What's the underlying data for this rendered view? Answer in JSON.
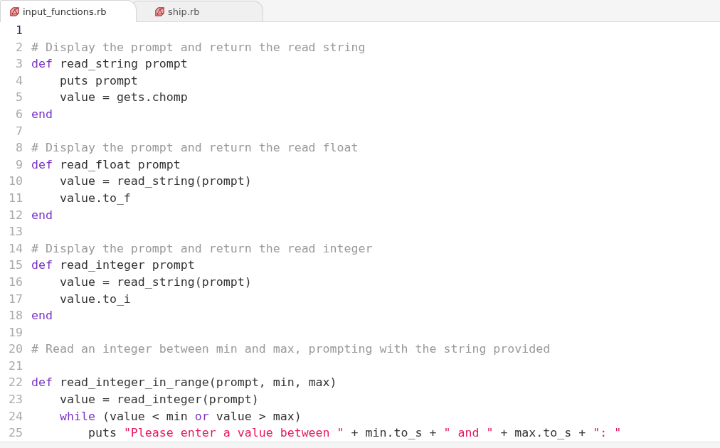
{
  "tabs": [
    {
      "label": "input_functions.rb",
      "selected": true
    },
    {
      "label": "ship.rb",
      "selected": false
    }
  ],
  "editor": {
    "lines": [
      {
        "number": "1",
        "current": true
      },
      {
        "number": "2",
        "tokens": [
          {
            "kind": "comment",
            "text": "# Display the prompt and return the read string"
          }
        ]
      },
      {
        "number": "3",
        "tokens": [
          {
            "kind": "keyword",
            "text": "def"
          },
          {
            "kind": "plain",
            "text": " read_string prompt"
          }
        ]
      },
      {
        "number": "4",
        "tokens": [
          {
            "kind": "plain",
            "text": "    puts prompt"
          }
        ]
      },
      {
        "number": "5",
        "tokens": [
          {
            "kind": "plain",
            "text": "    value = gets.chomp"
          }
        ]
      },
      {
        "number": "6",
        "tokens": [
          {
            "kind": "keyword",
            "text": "end"
          }
        ]
      },
      {
        "number": "7"
      },
      {
        "number": "8",
        "tokens": [
          {
            "kind": "comment",
            "text": "# Display the prompt and return the read float"
          }
        ]
      },
      {
        "number": "9",
        "tokens": [
          {
            "kind": "keyword",
            "text": "def"
          },
          {
            "kind": "plain",
            "text": " read_float prompt"
          }
        ]
      },
      {
        "number": "10",
        "tokens": [
          {
            "kind": "plain",
            "text": "    value = read_string(prompt)"
          }
        ]
      },
      {
        "number": "11",
        "tokens": [
          {
            "kind": "plain",
            "text": "    value.to_f"
          }
        ]
      },
      {
        "number": "12",
        "tokens": [
          {
            "kind": "keyword",
            "text": "end"
          }
        ]
      },
      {
        "number": "13"
      },
      {
        "number": "14",
        "tokens": [
          {
            "kind": "comment",
            "text": "# Display the prompt and return the read integer"
          }
        ]
      },
      {
        "number": "15",
        "tokens": [
          {
            "kind": "keyword",
            "text": "def"
          },
          {
            "kind": "plain",
            "text": " read_integer prompt"
          }
        ]
      },
      {
        "number": "16",
        "tokens": [
          {
            "kind": "plain",
            "text": "    value = read_string(prompt)"
          }
        ]
      },
      {
        "number": "17",
        "tokens": [
          {
            "kind": "plain",
            "text": "    value.to_i"
          }
        ]
      },
      {
        "number": "18",
        "tokens": [
          {
            "kind": "keyword",
            "text": "end"
          }
        ]
      },
      {
        "number": "19"
      },
      {
        "number": "20",
        "tokens": [
          {
            "kind": "comment",
            "text": "# Read an integer between min and max, prompting with the string provided"
          }
        ]
      },
      {
        "number": "21"
      },
      {
        "number": "22",
        "tokens": [
          {
            "kind": "keyword",
            "text": "def"
          },
          {
            "kind": "plain",
            "text": " read_integer_in_range(prompt, min, max)"
          }
        ]
      },
      {
        "number": "23",
        "tokens": [
          {
            "kind": "plain",
            "text": "    value = read_integer(prompt)"
          }
        ]
      },
      {
        "number": "24",
        "indented": true,
        "tokens": [
          {
            "kind": "keyword",
            "text": "while"
          },
          {
            "kind": "plain",
            "text": " (value < min "
          },
          {
            "kind": "keyword",
            "text": "or"
          },
          {
            "kind": "plain",
            "text": " value > max)"
          }
        ]
      },
      {
        "number": "25",
        "tokens": [
          {
            "kind": "plain",
            "text": "        puts "
          },
          {
            "kind": "string",
            "text": "\"Please enter a value between \""
          },
          {
            "kind": "plain",
            "text": " + min.to_s + "
          },
          {
            "kind": "string",
            "text": "\" and \""
          },
          {
            "kind": "plain",
            "text": " + max.to_s + "
          },
          {
            "kind": "string",
            "text": "\": \""
          }
        ]
      }
    ]
  }
}
